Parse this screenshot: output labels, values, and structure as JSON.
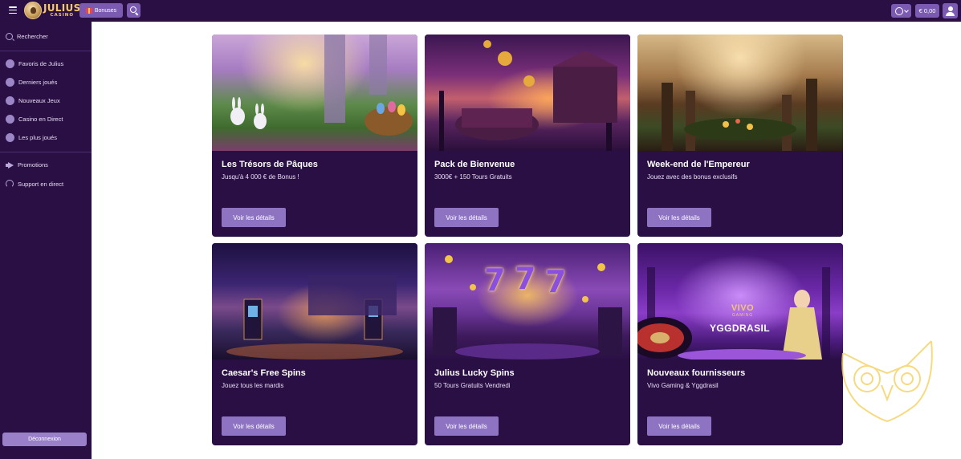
{
  "topbar": {
    "logo_title": "JULIUS",
    "logo_sub": "CASINO",
    "bonus_label": "Bonuses",
    "balance": "€ 0,00"
  },
  "sidebar": {
    "search_label": "Rechercher",
    "items": [
      {
        "label": "Favoris de Julius",
        "icon": "heart-icon"
      },
      {
        "label": "Derniers joués",
        "icon": "history-icon"
      },
      {
        "label": "Nouveaux Jeux",
        "icon": "star-icon"
      },
      {
        "label": "Casino en Direct",
        "icon": "live-icon"
      },
      {
        "label": "Les plus joués",
        "icon": "fire-icon"
      }
    ],
    "promotions_label": "Promotions",
    "support_label": "Support en direct",
    "logout_label": "Déconnexion"
  },
  "promotions": [
    {
      "title": "Les Trésors de Pâques",
      "subtitle": "Jusqu'à 4 000 € de Bonus !",
      "button": "Voir les détails"
    },
    {
      "title": "Pack de Bienvenue",
      "subtitle": "3000€ + 150 Tours Gratuits",
      "button": "Voir les détails"
    },
    {
      "title": "Week-end de l'Empereur",
      "subtitle": "Jouez avec des bonus exclusifs",
      "button": "Voir les détails"
    },
    {
      "title": "Caesar's Free Spins",
      "subtitle": "Jouez tous les mardis",
      "button": "Voir les détails"
    },
    {
      "title": "Julius Lucky Spins",
      "subtitle": "50 Tours Gratuits Vendredi",
      "button": "Voir les détails"
    },
    {
      "title": "Nouveaux fournisseurs",
      "subtitle": "Vivo Gaming & Yggdrasil",
      "button": "Voir les détails"
    }
  ],
  "art_text": {
    "sevens": "7",
    "vivo_main": "VIVO",
    "vivo_sub": "GAMING",
    "yggdrasil": "YGGDRASIL"
  },
  "colors": {
    "sidebar_bg": "#2a0f45",
    "card_bg": "#2a0f45",
    "button_bg": "#8f73c3",
    "accent_gold": "#f3c96b"
  }
}
